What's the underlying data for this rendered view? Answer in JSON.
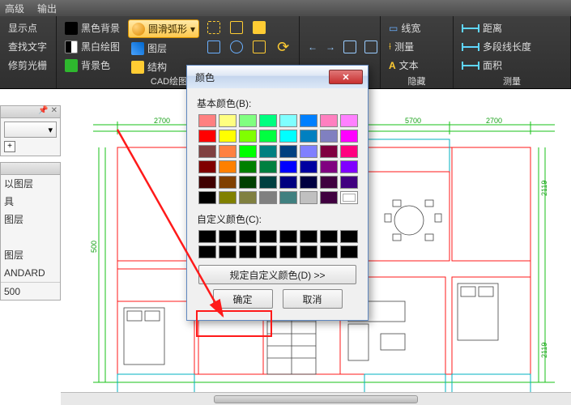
{
  "menu": {
    "items": [
      "高级",
      "输出"
    ]
  },
  "ribbon": {
    "g1": {
      "items": [
        "显示点",
        "查找文字",
        "修剪光栅"
      ]
    },
    "g2": {
      "title": "CAD绘图设置",
      "col1": [
        "黑色背景",
        "黑白绘图",
        "背景色"
      ],
      "highlight": "圆滑弧形",
      "col2_rest": [
        "图层",
        "结构"
      ]
    },
    "g3": {
      "title": "隐藏",
      "items": [
        "线宽",
        "测量",
        "文本"
      ]
    },
    "g4": {
      "title": "测量",
      "items": [
        "距离",
        "多段线长度",
        "面积"
      ]
    }
  },
  "left": {
    "dropdown_value": "",
    "rows": [
      "以图层",
      "具",
      "图层",
      "",
      "图层",
      "ANDARD",
      "500"
    ]
  },
  "dialog": {
    "title": "颜色",
    "basic_label": "基本颜色(B):",
    "custom_label": "自定义颜色(C):",
    "define_btn": "规定自定义颜色(D) >>",
    "ok": "确定",
    "cancel": "取消",
    "basic_colors": [
      "#ff8080",
      "#ffff80",
      "#80ff80",
      "#00ff80",
      "#80ffff",
      "#0080ff",
      "#ff80c0",
      "#ff80ff",
      "#ff0000",
      "#ffff00",
      "#80ff00",
      "#00ff40",
      "#00ffff",
      "#0080c0",
      "#8080c0",
      "#ff00ff",
      "#804040",
      "#ff8040",
      "#00ff00",
      "#008080",
      "#004080",
      "#8080ff",
      "#800040",
      "#ff0080",
      "#800000",
      "#ff8000",
      "#008000",
      "#008040",
      "#0000ff",
      "#0000a0",
      "#800080",
      "#8000ff",
      "#400000",
      "#804000",
      "#004000",
      "#004040",
      "#000080",
      "#000040",
      "#400040",
      "#400080",
      "#000000",
      "#808000",
      "#808040",
      "#808080",
      "#408080",
      "#c0c0c0",
      "#400040",
      ""
    ]
  },
  "dims": [
    "2700",
    "2700",
    "5700",
    "2700",
    "2119",
    "500",
    "2119"
  ]
}
